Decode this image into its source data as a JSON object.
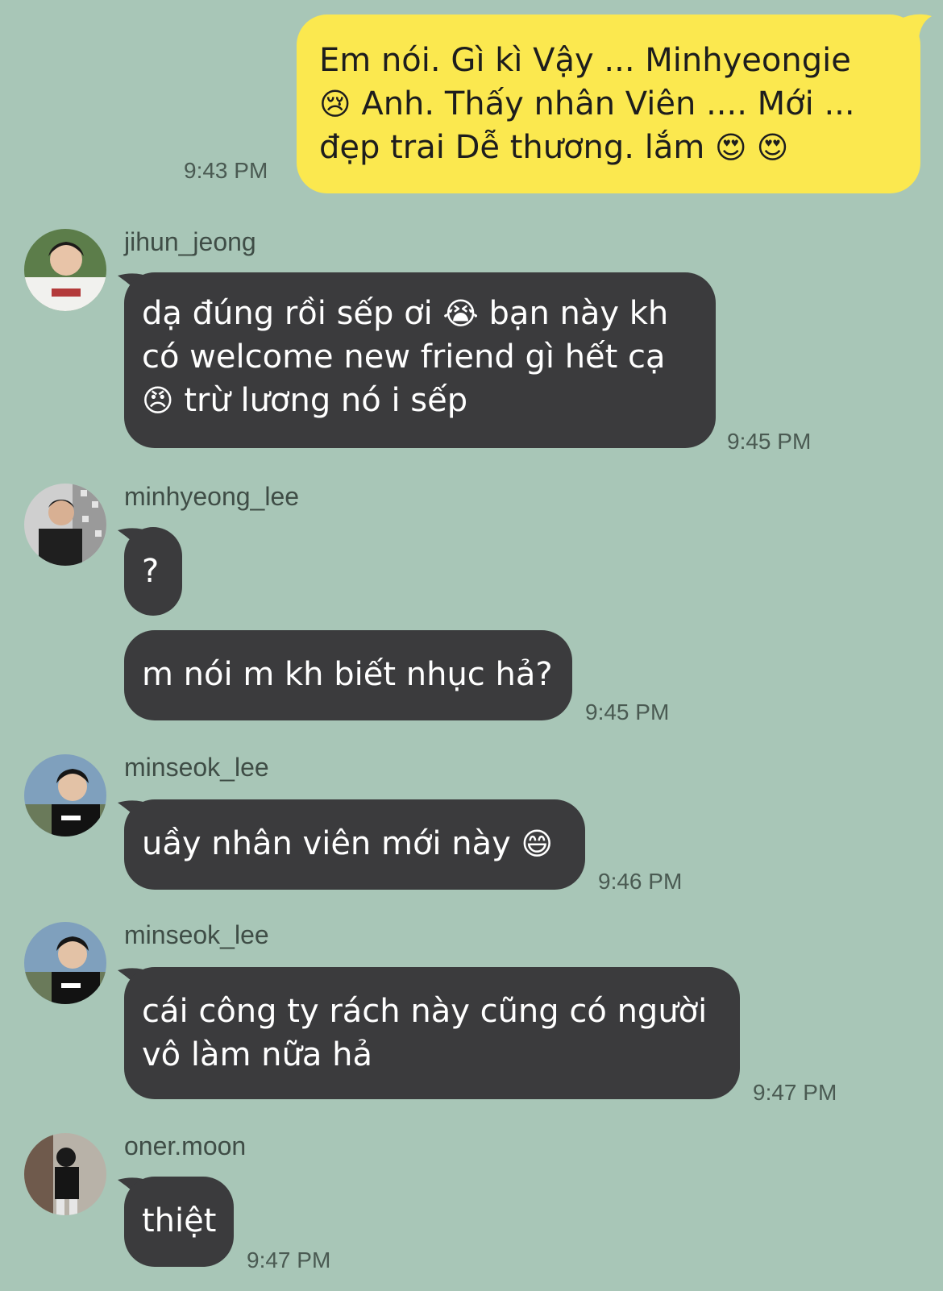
{
  "messages": {
    "m1": {
      "text_a": "Em nói.  Gì kì Vậy ... Minhyeongie",
      "emoji_a": "😢",
      "text_b": " Anh.  Thấy nhân Viên .... Mới ...",
      "text_c": "đẹp trai Dễ thương.  lắm ",
      "emoji_c": "😍 😍",
      "time": "9:43 PM"
    },
    "m2": {
      "sender": "jihun_jeong",
      "text_a": "dạ đúng rồi sếp ơi ",
      "emoji_a": "😭",
      "text_b": " bạn này kh",
      "text_c": "có welcome new friend gì hết cạ",
      "emoji_d": "😠",
      "text_d": " trừ lương nó i sếp",
      "time": "9:45 PM"
    },
    "m3": {
      "sender": "minhyeong_lee",
      "text": "?"
    },
    "m4": {
      "text": "m nói m kh biết nhục hả?",
      "time": "9:45 PM"
    },
    "m5": {
      "sender": "minseok_lee",
      "text": "uầy nhân viên mới này ",
      "emoji": "😄",
      "time": "9:46 PM"
    },
    "m6": {
      "sender": "minseok_lee",
      "text_a": "cái công ty rách này cũng có người",
      "text_b": "vô làm nữa hả",
      "time": "9:47 PM"
    },
    "m7": {
      "sender": "oner.moon",
      "text": "thiệt",
      "time": "9:47 PM"
    }
  },
  "colors": {
    "background": "#a8c6b7",
    "outgoing": "#fbe84f",
    "incoming": "#3b3b3d"
  },
  "icons": [
    "avatar-jihun",
    "avatar-minhyeong",
    "avatar-minseok",
    "avatar-oner"
  ]
}
